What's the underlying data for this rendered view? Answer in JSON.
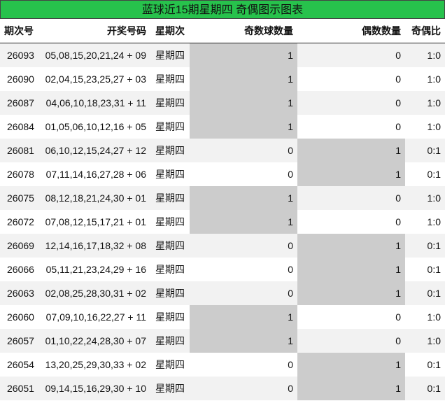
{
  "title": "蓝球近15期星期四 奇偶图示图表",
  "headers": {
    "period": "期次号",
    "numbers": "开奖号码",
    "weekday": "星期次",
    "odd_count": "奇数球数量",
    "even_count": "偶数数量",
    "ratio": "奇偶比"
  },
  "colors": {
    "title_bg": "#27c24c",
    "highlight": "#cccccc",
    "zebra": "#f2f2f2"
  },
  "rows": [
    {
      "period": "26093",
      "numbers": "05,08,15,20,21,24 + 09",
      "weekday": "星期四",
      "odd": "1",
      "even": "0",
      "ratio": "1:0"
    },
    {
      "period": "26090",
      "numbers": "02,04,15,23,25,27 + 03",
      "weekday": "星期四",
      "odd": "1",
      "even": "0",
      "ratio": "1:0"
    },
    {
      "period": "26087",
      "numbers": "04,06,10,18,23,31 + 11",
      "weekday": "星期四",
      "odd": "1",
      "even": "0",
      "ratio": "1:0"
    },
    {
      "period": "26084",
      "numbers": "01,05,06,10,12,16 + 05",
      "weekday": "星期四",
      "odd": "1",
      "even": "0",
      "ratio": "1:0"
    },
    {
      "period": "26081",
      "numbers": "06,10,12,15,24,27 + 12",
      "weekday": "星期四",
      "odd": "0",
      "even": "1",
      "ratio": "0:1"
    },
    {
      "period": "26078",
      "numbers": "07,11,14,16,27,28 + 06",
      "weekday": "星期四",
      "odd": "0",
      "even": "1",
      "ratio": "0:1"
    },
    {
      "period": "26075",
      "numbers": "08,12,18,21,24,30 + 01",
      "weekday": "星期四",
      "odd": "1",
      "even": "0",
      "ratio": "1:0"
    },
    {
      "period": "26072",
      "numbers": "07,08,12,15,17,21 + 01",
      "weekday": "星期四",
      "odd": "1",
      "even": "0",
      "ratio": "1:0"
    },
    {
      "period": "26069",
      "numbers": "12,14,16,17,18,32 + 08",
      "weekday": "星期四",
      "odd": "0",
      "even": "1",
      "ratio": "0:1"
    },
    {
      "period": "26066",
      "numbers": "05,11,21,23,24,29 + 16",
      "weekday": "星期四",
      "odd": "0",
      "even": "1",
      "ratio": "0:1"
    },
    {
      "period": "26063",
      "numbers": "02,08,25,28,30,31 + 02",
      "weekday": "星期四",
      "odd": "0",
      "even": "1",
      "ratio": "0:1"
    },
    {
      "period": "26060",
      "numbers": "07,09,10,16,22,27 + 11",
      "weekday": "星期四",
      "odd": "1",
      "even": "0",
      "ratio": "1:0"
    },
    {
      "period": "26057",
      "numbers": "01,10,22,24,28,30 + 07",
      "weekday": "星期四",
      "odd": "1",
      "even": "0",
      "ratio": "1:0"
    },
    {
      "period": "26054",
      "numbers": "13,20,25,29,30,33 + 02",
      "weekday": "星期四",
      "odd": "0",
      "even": "1",
      "ratio": "0:1"
    },
    {
      "period": "26051",
      "numbers": "09,14,15,16,29,30 + 10",
      "weekday": "星期四",
      "odd": "0",
      "even": "1",
      "ratio": "0:1"
    }
  ]
}
